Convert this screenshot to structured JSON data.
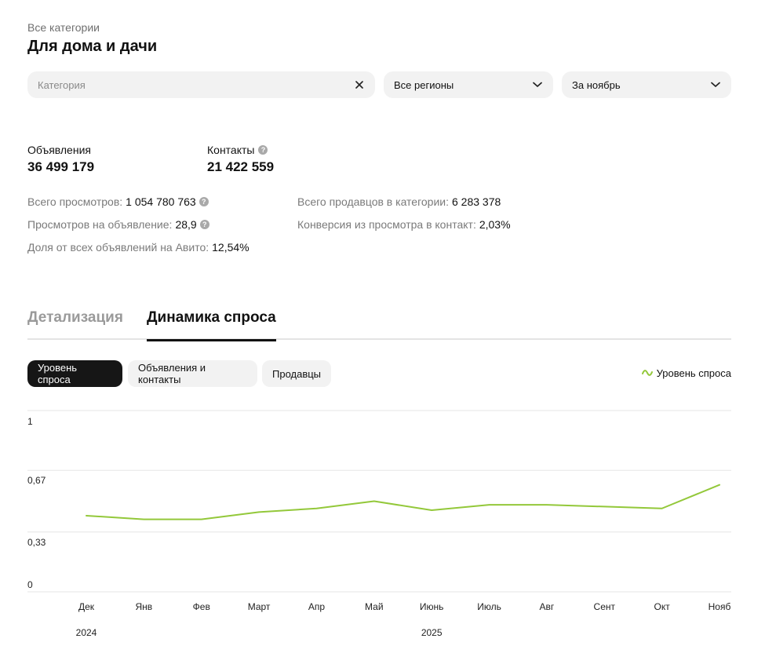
{
  "header": {
    "breadcrumb": "Все категории",
    "title": "Для дома и дачи"
  },
  "filters": {
    "category_placeholder": "Категория",
    "region": "Все регионы",
    "period": "За ноябрь"
  },
  "kpis": {
    "ads_label": "Объявления",
    "ads_value": "36 499 179",
    "contacts_label": "Контакты",
    "contacts_value": "21 422 559"
  },
  "stats": {
    "views_label": "Всего просмотров:",
    "views_value": "1 054 780 763",
    "views_per_ad_label": "Просмотров на объявление:",
    "views_per_ad_value": "28,9",
    "share_label": "Доля от всех объявлений на Авито:",
    "share_value": "12,54%",
    "sellers_label": "Всего продавцов в категории:",
    "sellers_value": "6 283 378",
    "conversion_label": "Конверсия из просмотра в контакт:",
    "conversion_value": "2,03%"
  },
  "tabs": [
    {
      "label": "Детализация"
    },
    {
      "label": "Динамика спроса"
    }
  ],
  "segments": [
    {
      "label": "Уровень спроса"
    },
    {
      "label": "Объявления и контакты"
    },
    {
      "label": "Продавцы"
    }
  ],
  "legend": {
    "label": "Уровень спроса"
  },
  "colors": {
    "accent_line": "#93c83a",
    "active_segment": "#161616"
  },
  "chart_data": {
    "type": "line",
    "categories": [
      "Дек",
      "Янв",
      "Фев",
      "Март",
      "Апр",
      "Май",
      "Июнь",
      "Июль",
      "Авг",
      "Сент",
      "Окт",
      "Нояб"
    ],
    "years": [
      {
        "label": "2024",
        "index": 0
      },
      {
        "label": "2025",
        "index": 6
      }
    ],
    "y_ticks": [
      {
        "value": 1,
        "label": "1"
      },
      {
        "value": 0.67,
        "label": "0,67"
      },
      {
        "value": 0.33,
        "label": "0,33"
      },
      {
        "value": 0,
        "label": "0"
      }
    ],
    "ylim": [
      0,
      1
    ],
    "grid": true,
    "legend_position": "top-right",
    "series": [
      {
        "name": "Уровень спроса",
        "values": [
          0.42,
          0.4,
          0.4,
          0.44,
          0.46,
          0.5,
          0.45,
          0.48,
          0.48,
          0.47,
          0.46,
          0.59
        ]
      }
    ]
  }
}
